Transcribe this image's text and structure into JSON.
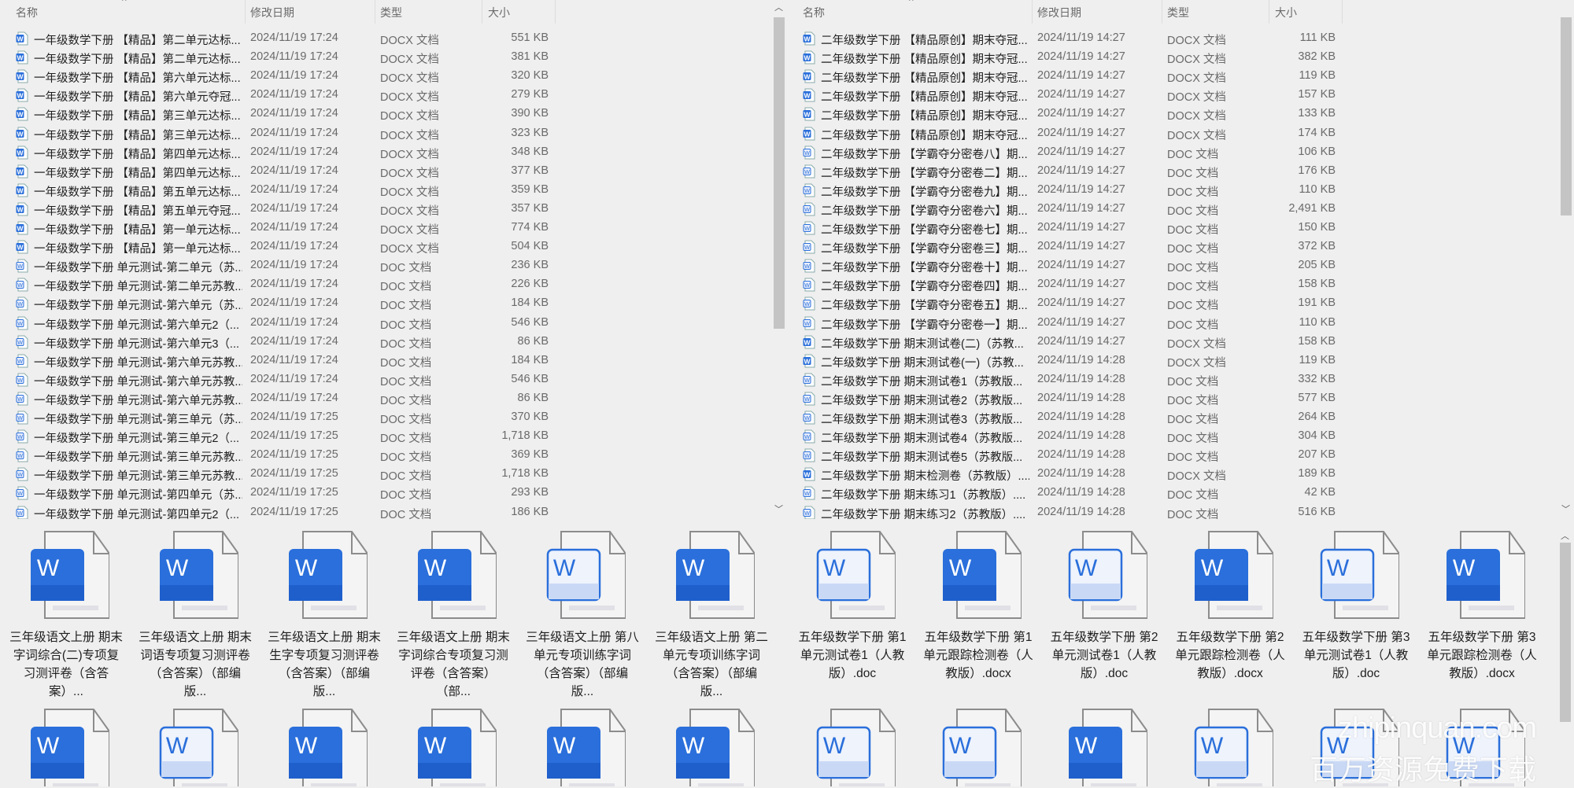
{
  "columns": {
    "name": "名称",
    "date": "修改日期",
    "type": "类型",
    "size": "大小"
  },
  "left_list": [
    {
      "name": "一年级数学下册 【精品】第二单元达标...",
      "date": "2024/11/19 17:24",
      "type": "DOCX 文档",
      "size": "551 KB"
    },
    {
      "name": "一年级数学下册 【精品】第二单元达标...",
      "date": "2024/11/19 17:24",
      "type": "DOCX 文档",
      "size": "381 KB"
    },
    {
      "name": "一年级数学下册 【精品】第六单元达标...",
      "date": "2024/11/19 17:24",
      "type": "DOCX 文档",
      "size": "320 KB"
    },
    {
      "name": "一年级数学下册 【精品】第六单元夺冠...",
      "date": "2024/11/19 17:24",
      "type": "DOCX 文档",
      "size": "279 KB"
    },
    {
      "name": "一年级数学下册 【精品】第三单元达标...",
      "date": "2024/11/19 17:24",
      "type": "DOCX 文档",
      "size": "390 KB"
    },
    {
      "name": "一年级数学下册 【精品】第三单元达标...",
      "date": "2024/11/19 17:24",
      "type": "DOCX 文档",
      "size": "323 KB"
    },
    {
      "name": "一年级数学下册 【精品】第四单元达标...",
      "date": "2024/11/19 17:24",
      "type": "DOCX 文档",
      "size": "348 KB"
    },
    {
      "name": "一年级数学下册 【精品】第四单元达标...",
      "date": "2024/11/19 17:24",
      "type": "DOCX 文档",
      "size": "377 KB"
    },
    {
      "name": "一年级数学下册 【精品】第五单元达标...",
      "date": "2024/11/19 17:24",
      "type": "DOCX 文档",
      "size": "359 KB"
    },
    {
      "name": "一年级数学下册 【精品】第五单元夺冠...",
      "date": "2024/11/19 17:24",
      "type": "DOCX 文档",
      "size": "357 KB"
    },
    {
      "name": "一年级数学下册 【精品】第一单元达标...",
      "date": "2024/11/19 17:24",
      "type": "DOCX 文档",
      "size": "774 KB"
    },
    {
      "name": "一年级数学下册 【精品】第一单元达标...",
      "date": "2024/11/19 17:24",
      "type": "DOCX 文档",
      "size": "504 KB"
    },
    {
      "name": "一年级数学下册 单元测试-第二单元（苏...",
      "date": "2024/11/19 17:24",
      "type": "DOC 文档",
      "size": "236 KB"
    },
    {
      "name": "一年级数学下册 单元测试-第二单元苏教...",
      "date": "2024/11/19 17:24",
      "type": "DOC 文档",
      "size": "226 KB"
    },
    {
      "name": "一年级数学下册 单元测试-第六单元（苏...",
      "date": "2024/11/19 17:24",
      "type": "DOC 文档",
      "size": "184 KB"
    },
    {
      "name": "一年级数学下册 单元测试-第六单元2（...",
      "date": "2024/11/19 17:24",
      "type": "DOC 文档",
      "size": "546 KB"
    },
    {
      "name": "一年级数学下册 单元测试-第六单元3（...",
      "date": "2024/11/19 17:24",
      "type": "DOC 文档",
      "size": "86 KB"
    },
    {
      "name": "一年级数学下册 单元测试-第六单元苏教...",
      "date": "2024/11/19 17:24",
      "type": "DOC 文档",
      "size": "184 KB"
    },
    {
      "name": "一年级数学下册 单元测试-第六单元苏教...",
      "date": "2024/11/19 17:24",
      "type": "DOC 文档",
      "size": "546 KB"
    },
    {
      "name": "一年级数学下册 单元测试-第六单元苏教...",
      "date": "2024/11/19 17:24",
      "type": "DOC 文档",
      "size": "86 KB"
    },
    {
      "name": "一年级数学下册 单元测试-第三单元（苏...",
      "date": "2024/11/19 17:25",
      "type": "DOC 文档",
      "size": "370 KB"
    },
    {
      "name": "一年级数学下册 单元测试-第三单元2（...",
      "date": "2024/11/19 17:25",
      "type": "DOC 文档",
      "size": "1,718 KB"
    },
    {
      "name": "一年级数学下册 单元测试-第三单元苏教...",
      "date": "2024/11/19 17:25",
      "type": "DOC 文档",
      "size": "369 KB"
    },
    {
      "name": "一年级数学下册 单元测试-第三单元苏教...",
      "date": "2024/11/19 17:25",
      "type": "DOC 文档",
      "size": "1,718 KB"
    },
    {
      "name": "一年级数学下册 单元测试-第四单元（苏...",
      "date": "2024/11/19 17:25",
      "type": "DOC 文档",
      "size": "293 KB"
    },
    {
      "name": "一年级数学下册 单元测试-第四单元2（...",
      "date": "2024/11/19 17:25",
      "type": "DOC 文档",
      "size": "186 KB"
    }
  ],
  "right_list": [
    {
      "name": "二年级数学下册 【精品原创】期末夺冠...",
      "date": "2024/11/19 14:27",
      "type": "DOCX 文档",
      "size": "111 KB"
    },
    {
      "name": "二年级数学下册 【精品原创】期末夺冠...",
      "date": "2024/11/19 14:27",
      "type": "DOCX 文档",
      "size": "382 KB"
    },
    {
      "name": "二年级数学下册 【精品原创】期末夺冠...",
      "date": "2024/11/19 14:27",
      "type": "DOCX 文档",
      "size": "119 KB"
    },
    {
      "name": "二年级数学下册 【精品原创】期末夺冠...",
      "date": "2024/11/19 14:27",
      "type": "DOCX 文档",
      "size": "157 KB"
    },
    {
      "name": "二年级数学下册 【精品原创】期末夺冠...",
      "date": "2024/11/19 14:27",
      "type": "DOCX 文档",
      "size": "133 KB"
    },
    {
      "name": "二年级数学下册 【精品原创】期末夺冠...",
      "date": "2024/11/19 14:27",
      "type": "DOCX 文档",
      "size": "174 KB"
    },
    {
      "name": "二年级数学下册 【学霸夺分密卷八】期...",
      "date": "2024/11/19 14:27",
      "type": "DOC 文档",
      "size": "106 KB"
    },
    {
      "name": "二年级数学下册 【学霸夺分密卷二】期...",
      "date": "2024/11/19 14:27",
      "type": "DOC 文档",
      "size": "176 KB"
    },
    {
      "name": "二年级数学下册 【学霸夺分密卷九】期...",
      "date": "2024/11/19 14:27",
      "type": "DOC 文档",
      "size": "110 KB"
    },
    {
      "name": "二年级数学下册 【学霸夺分密卷六】期...",
      "date": "2024/11/19 14:27",
      "type": "DOC 文档",
      "size": "2,491 KB"
    },
    {
      "name": "二年级数学下册 【学霸夺分密卷七】期...",
      "date": "2024/11/19 14:27",
      "type": "DOC 文档",
      "size": "150 KB"
    },
    {
      "name": "二年级数学下册 【学霸夺分密卷三】期...",
      "date": "2024/11/19 14:27",
      "type": "DOC 文档",
      "size": "372 KB"
    },
    {
      "name": "二年级数学下册 【学霸夺分密卷十】期...",
      "date": "2024/11/19 14:27",
      "type": "DOC 文档",
      "size": "205 KB"
    },
    {
      "name": "二年级数学下册 【学霸夺分密卷四】期...",
      "date": "2024/11/19 14:27",
      "type": "DOC 文档",
      "size": "158 KB"
    },
    {
      "name": "二年级数学下册 【学霸夺分密卷五】期...",
      "date": "2024/11/19 14:27",
      "type": "DOC 文档",
      "size": "191 KB"
    },
    {
      "name": "二年级数学下册 【学霸夺分密卷一】期...",
      "date": "2024/11/19 14:27",
      "type": "DOC 文档",
      "size": "110 KB"
    },
    {
      "name": "二年级数学下册 期末测试卷(二)（苏教...",
      "date": "2024/11/19 14:27",
      "type": "DOCX 文档",
      "size": "158 KB"
    },
    {
      "name": "二年级数学下册 期末测试卷(一)（苏教...",
      "date": "2024/11/19 14:28",
      "type": "DOCX 文档",
      "size": "119 KB"
    },
    {
      "name": "二年级数学下册 期末测试卷1（苏教版...",
      "date": "2024/11/19 14:28",
      "type": "DOC 文档",
      "size": "332 KB"
    },
    {
      "name": "二年级数学下册 期末测试卷2（苏教版...",
      "date": "2024/11/19 14:28",
      "type": "DOC 文档",
      "size": "577 KB"
    },
    {
      "name": "二年级数学下册 期末测试卷3（苏教版...",
      "date": "2024/11/19 14:28",
      "type": "DOC 文档",
      "size": "264 KB"
    },
    {
      "name": "二年级数学下册 期末测试卷4（苏教版...",
      "date": "2024/11/19 14:28",
      "type": "DOC 文档",
      "size": "304 KB"
    },
    {
      "name": "二年级数学下册 期末测试卷5（苏教版...",
      "date": "2024/11/19 14:28",
      "type": "DOC 文档",
      "size": "207 KB"
    },
    {
      "name": "二年级数学下册 期末检测卷（苏教版）....",
      "date": "2024/11/19 14:28",
      "type": "DOCX 文档",
      "size": "189 KB"
    },
    {
      "name": "二年级数学下册 期末练习1（苏教版）....",
      "date": "2024/11/19 14:28",
      "type": "DOC 文档",
      "size": "42 KB"
    },
    {
      "name": "二年级数学下册 期末练习2（苏教版）....",
      "date": "2024/11/19 14:28",
      "type": "DOC 文档",
      "size": "516 KB"
    }
  ],
  "left_grid": [
    {
      "label": "三年级语文上册 期末 字词综合(二)专项复习测评卷（含答案）...",
      "style": "solid"
    },
    {
      "label": "三年级语文上册 期末 词语专项复习测评卷（含答案）（部编版...",
      "style": "solid"
    },
    {
      "label": "三年级语文上册 期末 生字专项复习测评卷（含答案）（部编版...",
      "style": "solid"
    },
    {
      "label": "三年级语文上册 期末 字词综合专项复习测评卷（含答案）（部...",
      "style": "solid"
    },
    {
      "label": "三年级语文上册 第八单元专项训练字词（含答案）（部编版...",
      "style": "outline"
    },
    {
      "label": "三年级语文上册 第二单元专项训练字词（含答案）（部编版...",
      "style": "solid"
    },
    {
      "label": "",
      "style": "solid"
    },
    {
      "label": "",
      "style": "outline"
    },
    {
      "label": "",
      "style": "solid"
    },
    {
      "label": "",
      "style": "solid"
    },
    {
      "label": "",
      "style": "solid"
    },
    {
      "label": "",
      "style": "solid"
    }
  ],
  "right_grid": [
    {
      "label": "五年级数学下册 第1单元测试卷1（人教版）.doc",
      "style": "outline"
    },
    {
      "label": "五年级数学下册 第1单元跟踪检测卷（人教版）.docx",
      "style": "solid"
    },
    {
      "label": "五年级数学下册 第2单元测试卷1（人教版）.doc",
      "style": "outline"
    },
    {
      "label": "五年级数学下册 第2单元跟踪检测卷（人教版）.docx",
      "style": "solid"
    },
    {
      "label": "五年级数学下册 第3单元测试卷1（人教版）.doc",
      "style": "outline"
    },
    {
      "label": "五年级数学下册 第3单元跟踪检测卷（人教版）.docx",
      "style": "solid"
    },
    {
      "label": "",
      "style": "outline"
    },
    {
      "label": "",
      "style": "outline"
    },
    {
      "label": "",
      "style": "solid"
    },
    {
      "label": "",
      "style": "outline"
    },
    {
      "label": "",
      "style": "outline"
    },
    {
      "label": "",
      "style": "outline"
    }
  ],
  "watermark": {
    "line1": "zhipinquan.com",
    "line2": "百万资源免费下载"
  },
  "colors": {
    "word_blue": "#2a6fdb",
    "word_light": "#c9d9f5",
    "background": "#efefef",
    "scroll_thumb": "#c4c4c4"
  }
}
